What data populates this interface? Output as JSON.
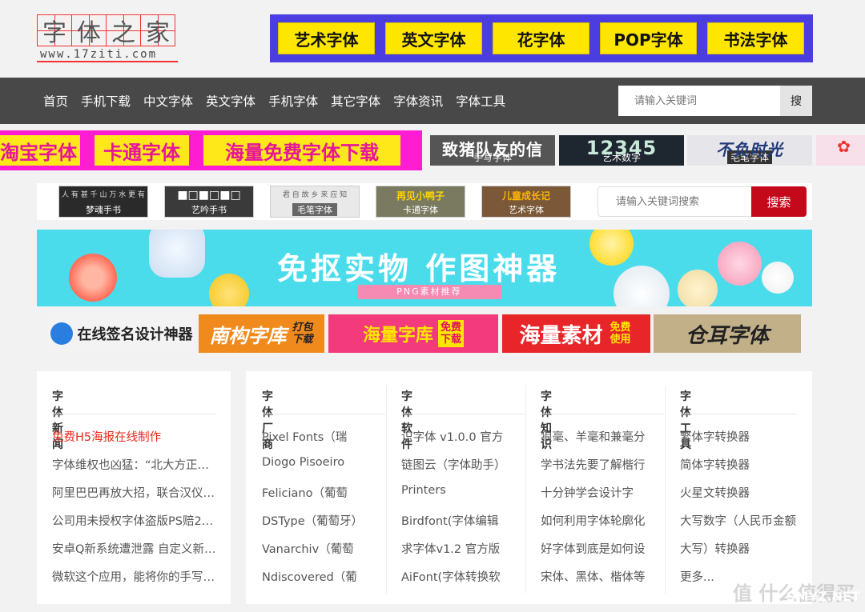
{
  "logo": {
    "chars": [
      "字",
      "体",
      "之",
      "家"
    ],
    "url": "www.17ziti.com"
  },
  "categories": [
    "艺术字体",
    "英文字体",
    "花字体",
    "POP字体",
    "书法字体"
  ],
  "nav": {
    "items": [
      "首页",
      "手机下载",
      "中文字体",
      "英文字体",
      "手机字体",
      "其它字体",
      "字体资讯",
      "字体工具"
    ],
    "search_placeholder": "请输入关键词",
    "search_button": "搜"
  },
  "strip": {
    "pink_tiles": [
      "淘宝字体",
      "卡通字体",
      "海量免费字体下载"
    ],
    "dark_tiles": [
      {
        "big": "致猪队友的信",
        "label": "手写字体"
      },
      {
        "big": "12345",
        "label": "艺术数字"
      },
      {
        "big": "不负时光",
        "label": "毛笔字体"
      }
    ]
  },
  "thumbs": [
    "梦魂手书",
    "艺吟手书",
    "毛笔字体",
    "卡通字体",
    "艺术字体"
  ],
  "thumb_tops": [
    "再见小鸭子",
    "儿童成长记"
  ],
  "search2": {
    "placeholder": "请输入关键词搜索",
    "button": "搜索"
  },
  "bigbanner": {
    "title": "免抠实物 作图神器",
    "subtitle": "PNG素材推荐"
  },
  "ads": [
    {
      "text": "在线签名设计神器",
      "small": ""
    },
    {
      "text": "南构字库",
      "small": "打包下载"
    },
    {
      "text": "海量字库",
      "small": "免费下载"
    },
    {
      "text": "海量素材",
      "small": "免费使用"
    },
    {
      "text": "仓耳字体",
      "small": ""
    }
  ],
  "news": {
    "title": "字体新闻",
    "items": [
      "免费H5海报在线制作",
      "字体维权也凶猛：“北大方正…",
      "阿里巴巴再放大招，联合汉仪…",
      "公司用未授权字体盗版PS赔2…",
      "安卓Q新系统遭泄露 自定义新…",
      "微软这个应用，能将你的手写…"
    ]
  },
  "columns": [
    {
      "title": "字体厂商",
      "items": [
        "Pixel Fonts（瑞",
        "Diogo Pisoeiro",
        "Feliciano（葡萄",
        "DSType（葡萄牙）",
        "Vanarchiv（葡萄",
        "Ndiscovered（葡"
      ]
    },
    {
      "title": "字体软件",
      "items": [
        "识字体 v1.0.0 官方",
        "链图云（字体助手）",
        "Printers",
        "Birdfont(字体编辑",
        "求字体v1.2 官方版",
        "AiFont(字体转换软"
      ]
    },
    {
      "title": "字体知识",
      "items": [
        "狼毫、羊毫和兼毫分",
        "学书法先要了解楷行",
        "十分钟学会设计字",
        "如何利用字体轮廓化",
        "好字体到底是如何设",
        "宋体、黑体、楷体等"
      ]
    },
    {
      "title": "字体工具",
      "items": [
        "繁体字转换器",
        "简体字转换器",
        "火星文转换器",
        "大写数字（人民币金额",
        "大写）转换器",
        "更多..."
      ]
    }
  ],
  "watermark": "值 什么值得买",
  "watermark2": "SMYZ.NET"
}
